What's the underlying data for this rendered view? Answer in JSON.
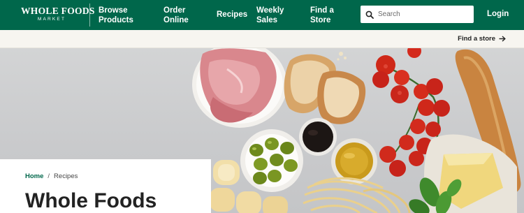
{
  "brand": {
    "name": "WHOLE FOODS",
    "sub": "MARKET"
  },
  "nav": {
    "items": [
      {
        "label_line1": "Browse",
        "label_line2": "Products"
      },
      {
        "label_line1": "Order",
        "label_line2": "Online"
      },
      {
        "label_line1": "Recipes",
        "label_line2": ""
      },
      {
        "label_line1": "Weekly",
        "label_line2": "Sales"
      },
      {
        "label_line1": "Find a",
        "label_line2": "Store"
      }
    ],
    "search_placeholder": "Search",
    "login_label": "Login"
  },
  "store_strip": {
    "find_store_label": "Find a store"
  },
  "breadcrumb": {
    "home": "Home",
    "separator": "/",
    "current": "Recipes"
  },
  "page": {
    "title": "Whole Foods"
  },
  "colors": {
    "brand_green": "#00674b",
    "strip_bg": "#f7f5f0"
  },
  "icons": {
    "search": "search-icon",
    "arrow": "arrow-right-icon"
  }
}
